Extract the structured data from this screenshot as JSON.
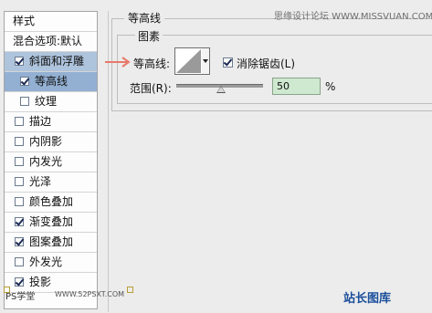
{
  "style_panel": {
    "title": "样式",
    "blend_options": "混合选项:默认",
    "items": [
      {
        "label": "斜面和浮雕",
        "checked": true,
        "selected": true
      },
      {
        "label": "等高线",
        "checked": true,
        "selected": true,
        "sub": true
      },
      {
        "label": "纹理",
        "checked": false,
        "selected": false,
        "sub": true
      },
      {
        "label": "描边",
        "checked": false
      },
      {
        "label": "内阴影",
        "checked": false
      },
      {
        "label": "内发光",
        "checked": false
      },
      {
        "label": "光泽",
        "checked": false
      },
      {
        "label": "颜色叠加",
        "checked": false
      },
      {
        "label": "渐变叠加",
        "checked": true
      },
      {
        "label": "图案叠加",
        "checked": true
      },
      {
        "label": "外发光",
        "checked": false
      },
      {
        "label": "投影",
        "checked": true
      }
    ]
  },
  "contour_panel": {
    "group_title": "等高线",
    "elements_title": "图素",
    "contour_label": "等高线:",
    "anti_alias_label": "消除锯齿(L)",
    "anti_alias_checked": true,
    "range_label": "范围(R):",
    "range_value": "50",
    "range_unit": "%"
  },
  "watermark": "思缘设计论坛 WWW.MISSVUAN.COM",
  "bottom_left_mark": "PS学堂",
  "bottom_left_url": "WWW.52PSXT.COM",
  "bottom_right_logo": "站长图库",
  "colors": {
    "selected_row": "#aec4dd",
    "range_field": "#cfe8d0",
    "arrow": "#e8796b"
  }
}
